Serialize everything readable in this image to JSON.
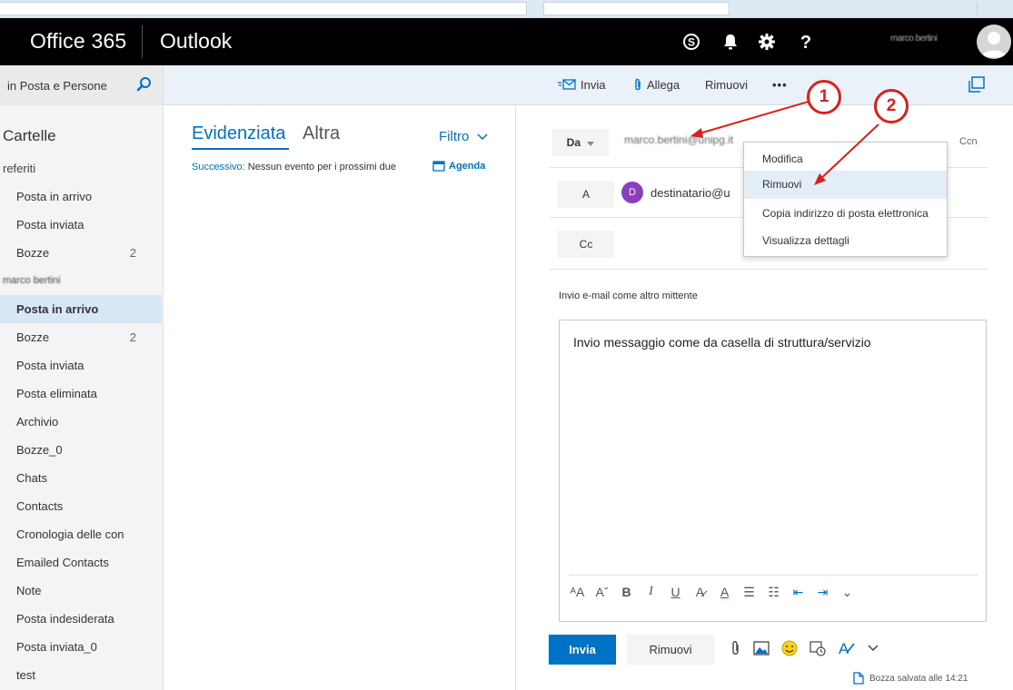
{
  "header": {
    "brand": "Office 365",
    "app": "Outlook",
    "user_name": "marco bertini"
  },
  "search": {
    "placeholder": "in Posta e Persone"
  },
  "toolbar": {
    "send": "Invia",
    "attach": "Allega",
    "remove": "Rimuovi",
    "more": "•••"
  },
  "folders": {
    "title": "Cartelle",
    "favorites_label": "referiti",
    "favorites": [
      {
        "label": "Posta in arrivo",
        "count": ""
      },
      {
        "label": "Posta inviata",
        "count": ""
      },
      {
        "label": "Bozze",
        "count": "2"
      }
    ],
    "account_label": "marco bertini",
    "items": [
      {
        "label": "Posta in arrivo",
        "count": ""
      },
      {
        "label": "Bozze",
        "count": "2"
      },
      {
        "label": "Posta inviata",
        "count": ""
      },
      {
        "label": "Posta eliminata",
        "count": ""
      },
      {
        "label": "Archivio",
        "count": ""
      },
      {
        "label": "Bozze_0",
        "count": ""
      },
      {
        "label": "Chats",
        "count": ""
      },
      {
        "label": "Contacts",
        "count": ""
      },
      {
        "label": "Cronologia delle con",
        "count": ""
      },
      {
        "label": "Emailed Contacts",
        "count": ""
      },
      {
        "label": "Note",
        "count": ""
      },
      {
        "label": "Posta indesiderata",
        "count": ""
      },
      {
        "label": "Posta inviata_0",
        "count": ""
      },
      {
        "label": "test",
        "count": ""
      }
    ]
  },
  "message_list": {
    "tab_focused": "Evidenziata",
    "tab_other": "Altra",
    "filter": "Filtro",
    "next_label": "Successivo:",
    "next_text": "Nessun evento per i prossimi due",
    "agenda": "Agenda"
  },
  "compose": {
    "from_button": "Da",
    "from_address": "marco.bertini@unipg.it",
    "to_button": "A",
    "to_chip_initial": "D",
    "to_chip_address": "destinatario@u",
    "cc_button": "Cc",
    "bcc_link": "Ccn",
    "note": "Invio e-mail come altro mittente",
    "body": "Invio messaggio come da casella di struttura/servizio",
    "send_button": "Invia",
    "discard_button": "Rimuovi",
    "saved_status": "Bozza salvata alle 14:21"
  },
  "format_bar": [
    "ᴬA",
    "Aˇ",
    "B",
    "I",
    "U",
    "A̷",
    "A",
    "☰",
    "☷",
    "⇤",
    "⇥",
    "⌄"
  ],
  "context_menu": {
    "items": [
      "Modifica",
      "Rimuovi",
      "Copia indirizzo di posta elettronica",
      "Visualizza dettagli"
    ],
    "hover_index": 1
  },
  "callouts": [
    "1",
    "2"
  ],
  "colors": {
    "accent": "#0072c6",
    "callout": "#d9201c",
    "appbar": "#000000"
  }
}
